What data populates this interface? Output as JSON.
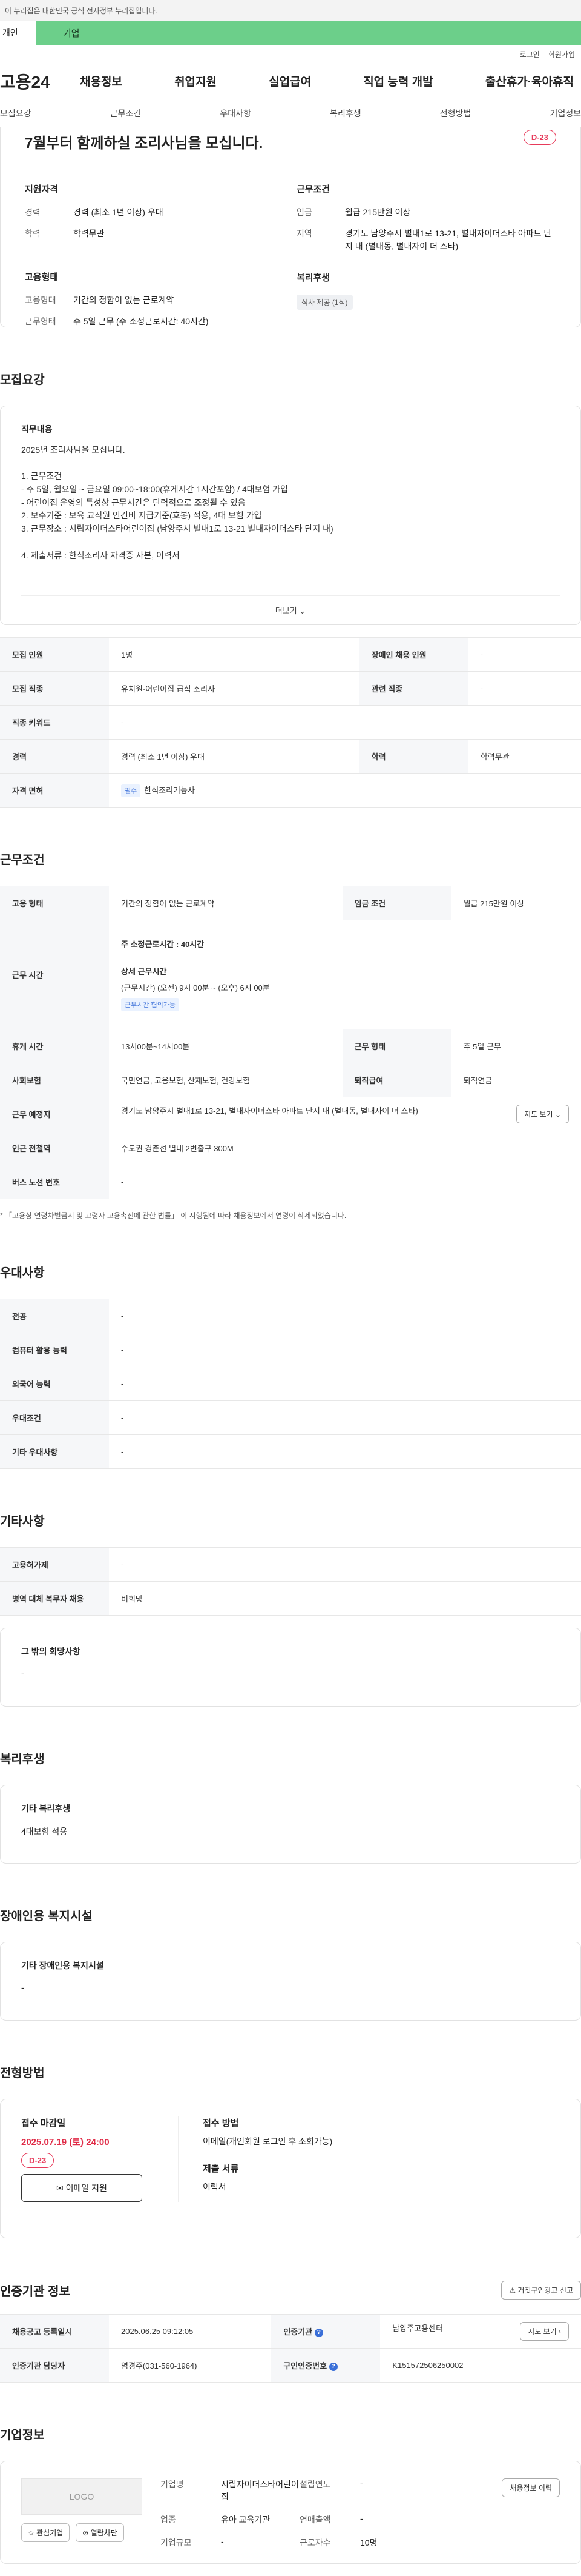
{
  "gov_bar": {
    "text": "이 누리집은 대한민국 공식 전자정부 누리집입니다."
  },
  "top_tabs": {
    "personal": "개인",
    "company": "기업"
  },
  "util": {
    "login": "로그인",
    "join": "회원가입"
  },
  "gnb": {
    "logo": "고용24",
    "menu": [
      "채용정보",
      "취업지원",
      "실업급여",
      "직업 능력 개발",
      "출산휴가·육아휴직"
    ]
  },
  "subnav": [
    "모집요강",
    "근무조건",
    "우대사항",
    "복리후생",
    "전형방법",
    "기업정보"
  ],
  "hero": {
    "title": "7월부터 함께하실 조리사님을 모십니다.",
    "dday": "D-23",
    "qual_title": "지원자격",
    "qual": [
      {
        "k": "경력",
        "v": "경력 (최소 1년 이상) 우대"
      },
      {
        "k": "학력",
        "v": "학력무관"
      }
    ],
    "emp_title": "고용형태",
    "emp": [
      {
        "k": "고용형태",
        "v": "기간의 정함이 없는 근로계약"
      },
      {
        "k": "근무형태",
        "v": "주 5일 근무 (주 소정근로시간: 40시간)"
      }
    ],
    "cond_title": "근무조건",
    "cond": [
      {
        "k": "임금",
        "v": "월급 215만원 이상"
      },
      {
        "k": "지역",
        "v": "경기도 남양주시 별내1로 13-21, 별내자이더스타 아파트 단지 내 (별내동, 별내자이 더 스타)"
      }
    ],
    "welfare_title": "복리후생",
    "welfare_chip": "식사 제공 (1식)"
  },
  "recruit": {
    "title": "모집요강",
    "desc_title": "직무내용",
    "desc": "2025년  조리사님을 모십니다.\n\n1. 근무조건\n    - 주 5일, 월요일 ~ 금요일 09:00~18:00(휴게시간 1시간포함) / 4대보험 가입\n    - 어린이집 운영의 특성상 근무시간은 탄력적으로 조정될 수 있음\n2. 보수기준 : 보육 교직원 인건비 지급기준(호봉) 적용, 4대 보험 가입\n3. 근무장소 : 시립자이더스타어린이집   (남양주시 별내1로 13-21 별내자이더스타 단지 내)\n\n4. 제출서류 : 한식조리사 자격증 사본, 이력서",
    "more": "더보기",
    "rows": [
      {
        "k1": "모집 인원",
        "v1": "1명",
        "k2": "장애인 채용 인원",
        "v2": "-"
      },
      {
        "k1": "모집 직종",
        "v1": "유치원·어린이집 급식 조리사",
        "k2": "관련 직종",
        "v2": "-"
      },
      {
        "k1": "직종 키워드",
        "v1": "-"
      },
      {
        "k1": "경력",
        "v1": "경력 (최소 1년 이상) 우대",
        "k2": "학력",
        "v2": "학력무관"
      },
      {
        "k1": "자격 면허",
        "cert": "필수",
        "v1": "한식조리기능사"
      }
    ]
  },
  "work": {
    "title": "근무조건",
    "type_k": "고용 형태",
    "type_v": "기간의 정함이 없는 근로계약",
    "wage_k": "임금 조건",
    "wage_v": "월급 215만원 이상",
    "hours_k": "근무 시간",
    "hours_week": "주 소정근로시간 : 40시간",
    "hours_detail_title": "상세 근무시간",
    "hours_detail": "(근무시간) (오전) 9시 00분 ~ (오후) 6시 00분",
    "hours_chip": "근무시간 협의가능",
    "rest_k": "휴게 시간",
    "rest_v": "13시00분~14시00분",
    "form_k": "근무 형태",
    "form_v": "주 5일 근무",
    "ins_k": "사회보험",
    "ins_v": "국민연금, 고용보험, 산재보험, 건강보험",
    "ret_k": "퇴직급여",
    "ret_v": "퇴직연금",
    "place_k": "근무 예정지",
    "place_v": "경기도 남양주시 별내1로 13-21, 별내자이더스타 아파트 단지 내 (별내동, 별내자이 더 스타)",
    "map": "지도 보기",
    "subway_k": "인근 전철역",
    "subway_v": "수도권 경춘선 별내 2번출구 300M",
    "bus_k": "버스 노선 번호",
    "bus_v": "-",
    "note": "* 「고용상 연령차별금지 및 고령자 고용촉진에 관한 법률」 이 시행됨에 따라 채용정보에서 연령이 삭제되었습니다."
  },
  "pref": {
    "title": "우대사항",
    "rows": [
      {
        "k": "전공",
        "v": "-"
      },
      {
        "k": "컴퓨터 활용 능력",
        "v": "-"
      },
      {
        "k": "외국어 능력",
        "v": "-"
      },
      {
        "k": "우대조건",
        "v": "-"
      },
      {
        "k": "기타 우대사항",
        "v": "-"
      }
    ]
  },
  "etc": {
    "title": "기타사항",
    "rows": [
      {
        "k": "고용허가제",
        "v": "-"
      },
      {
        "k": "병역 대체 복무자 채용",
        "v": "비희망"
      }
    ],
    "other_title": "그 밖의 희망사항",
    "other_v": "-"
  },
  "welfare": {
    "title": "복리후생",
    "box_title": "기타 복리후생",
    "box_v": "4대보험 적용"
  },
  "disabled": {
    "title": "장애인용 복지시설",
    "box_title": "기타 장애인용 복지시설",
    "box_v": "-"
  },
  "apply": {
    "title": "전형방법",
    "deadline_title": "접수 마감일",
    "deadline": "2025.07.19 (토) 24:00",
    "dday": "D-23",
    "btn": "이메일 지원",
    "method_title": "접수 방법",
    "method_v": "이메일(개인회원 로그인 후 조회가능)",
    "docs_title": "제출 서류",
    "docs_v": "이력서"
  },
  "auth": {
    "title": "인증기관 정보",
    "report_btn": "거짓구인광고 신고",
    "reg_k": "채용공고 등록일시",
    "reg_v": "2025.06.25 09:12:05",
    "org_k": "인증기관",
    "org_v": "남양주고용센터",
    "map": "지도 보기",
    "mgr_k": "인증기관 담당자",
    "mgr_v": "염경주(031-560-1964)",
    "no_k": "구인인증번호",
    "no_v": "K151572506250002"
  },
  "company": {
    "title": "기업정보",
    "logo": "LOGO",
    "fav": "관심기업",
    "block": "열람차단",
    "kv": [
      {
        "k": "기업명",
        "v": "시립자이더스타어린이집"
      },
      {
        "k": "설립연도",
        "v": "-"
      },
      {
        "k": "업종",
        "v": "유아 교육기관"
      },
      {
        "k": "연매출액",
        "v": "-"
      },
      {
        "k": "기업규모",
        "v": "-"
      },
      {
        "k": "근로자수",
        "v": "10명"
      }
    ],
    "jobs_btn": "채용정보 이력"
  }
}
